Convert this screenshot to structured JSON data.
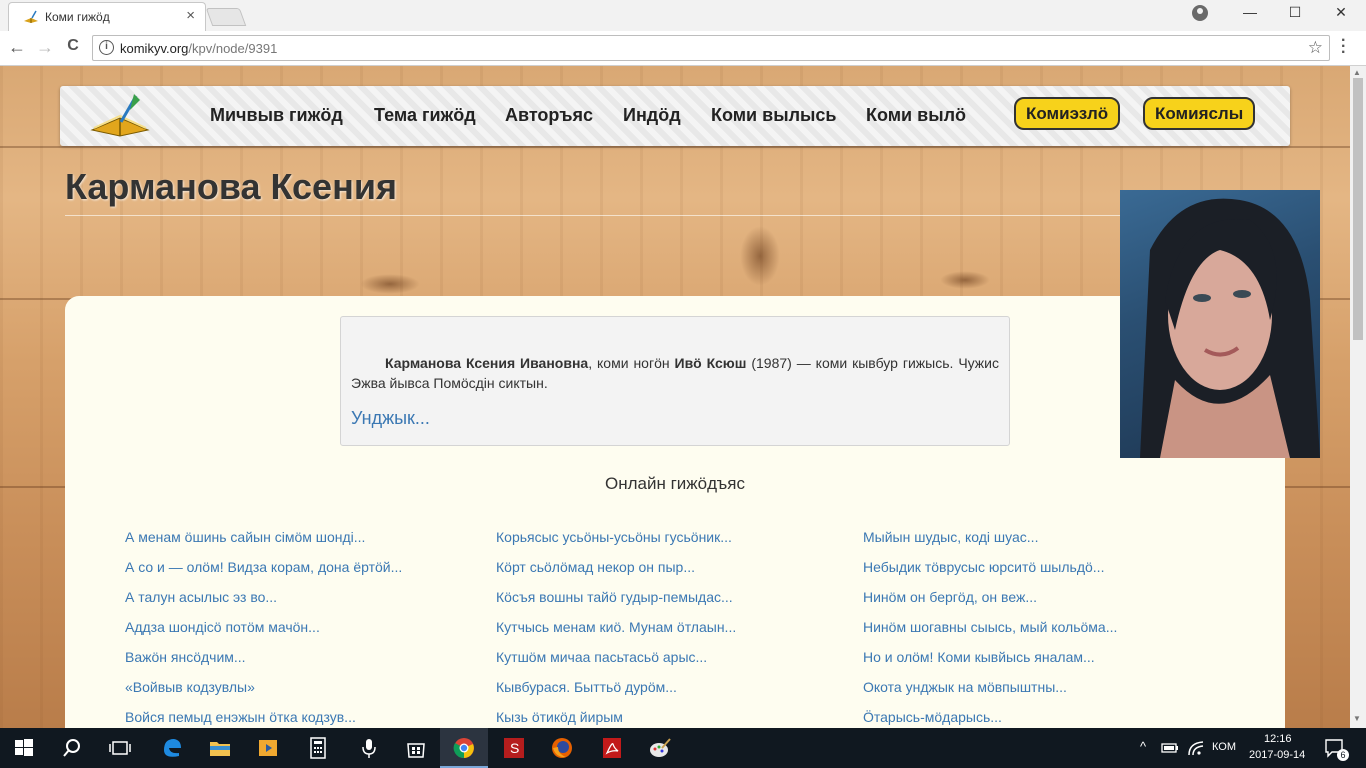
{
  "browser": {
    "tab_title": "Коми гижӧд",
    "tab_close": "×",
    "url_host": "komikyv.org",
    "url_path": "/kpv/node/9391",
    "back": "←",
    "forward": "→",
    "reload": "C",
    "star": "☆",
    "minimize": "—",
    "maximize": "☐",
    "close": "✕"
  },
  "site": {
    "nav": [
      "Мичвыв гижӧд",
      "Тема гижӧд",
      "Авторъяс",
      "Индӧд",
      "Коми вылысь",
      "Коми вылӧ"
    ],
    "buttons": [
      "Комиэзлӧ",
      "Комияслы"
    ]
  },
  "author": {
    "title": "Карманова Ксения",
    "full_name": "Карманова Ксения Ивановна",
    "bio_mid": ", коми ногӧн ",
    "pen_name": "Ивӧ Ксюш",
    "bio_rest": " (1987) — коми кывбур гижысь. Чужис Эжва йывса Помӧсдін сиктын.",
    "more": "Унджык..."
  },
  "works": {
    "title": "Онлайн гижӧдъяс",
    "columns": [
      [
        "А менам ӧшинь сайын сiмӧм шондi...",
        "А со и — олӧм! Видза корам, дона ёртӧй...",
        "А талун асылыс эз во...",
        "Аддза шондiсӧ потӧм мачӧн...",
        "Важӧн янсӧдчим...",
        "«Войвыв кодзувлы»",
        "Войся пемыд енэжын ӧтка кодзув..."
      ],
      [
        "Корьясыс усьӧны-усьӧны гусьӧник...",
        "Кӧрт сьӧлӧмад некор он пыр...",
        "Кӧсъя вошны тайӧ гудыр-пемыдас...",
        "Кутчысь менам киӧ. Мунам ӧтлаын...",
        "Кутшӧм мичаа пасьтасьӧ арыс...",
        "Кывбурася. Быттьӧ дурӧм...",
        "Кызь ӧтикӧд йирым"
      ],
      [
        "Мыйын шудыс, кодi шуас...",
        "Небыдик тӧврусыс юрситӧ шыльдӧ...",
        "Нинӧм он бергӧд, он веж...",
        "Нинӧм шогавны сыысь, мый кольӧма...",
        "Но и олӧм! Коми кывйысь яналам...",
        "Окота унджык на мӧвпыштны...",
        "Ӧтарысь-мӧдарысь..."
      ]
    ]
  },
  "taskbar": {
    "lang": "КОМ",
    "time": "12:16",
    "date": "2017-09-14",
    "notifications": "6"
  },
  "colors": {
    "link": "#3b78b3",
    "pill": "#f7d21b",
    "panel": "#fefdf0"
  }
}
